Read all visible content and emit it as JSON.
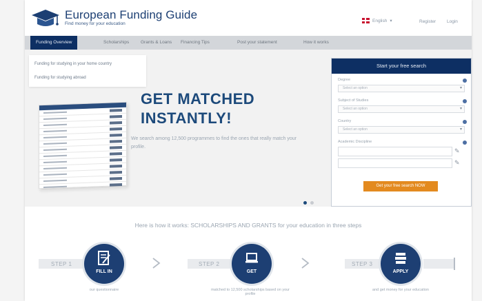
{
  "header": {
    "logo_title": "European Funding Guide",
    "logo_sub": "Find money for your education",
    "language": "English",
    "register": "Register",
    "login": "Login"
  },
  "nav": {
    "items": [
      "Funding Overview",
      "Scholarships",
      "Grants & Loans",
      "Financing Tips",
      "Post your statement",
      "How it works"
    ]
  },
  "dropdown": {
    "items": [
      "Funding for studying in your home country",
      "Funding for studying abroad"
    ]
  },
  "hero": {
    "title_line1": "GET MATCHED",
    "title_line2": "INSTANTLY!",
    "text": "We search among 12,500 programmes to find the ones that really match your profile."
  },
  "search": {
    "title": "Start your free search",
    "fields": [
      {
        "label": "Degree",
        "placeholder": "Select an option"
      },
      {
        "label": "Subject of Studies",
        "placeholder": "Select an option"
      },
      {
        "label": "Country",
        "placeholder": "Select an option"
      },
      {
        "label": "Academic Discipline",
        "placeholder": ""
      }
    ],
    "button": "Get your free search NOW"
  },
  "steps": {
    "heading": "Here is how it works: SCHOLARSHIPS AND GRANTS for your education in three steps",
    "items": [
      {
        "label": "STEP 1",
        "action": "FILL IN",
        "desc": "our questionnaire",
        "icon": "form-icon"
      },
      {
        "label": "STEP 2",
        "action": "GET",
        "desc": "matched to 12,500 scholarships based on your profile",
        "icon": "laptop-icon"
      },
      {
        "label": "STEP 3",
        "action": "APPLY",
        "desc": "and get money for your education",
        "icon": "books-icon"
      }
    ]
  },
  "colors": {
    "navy": "#0d2f63",
    "accent_orange": "#e38a1f",
    "title_blue": "#1d4a7b"
  }
}
